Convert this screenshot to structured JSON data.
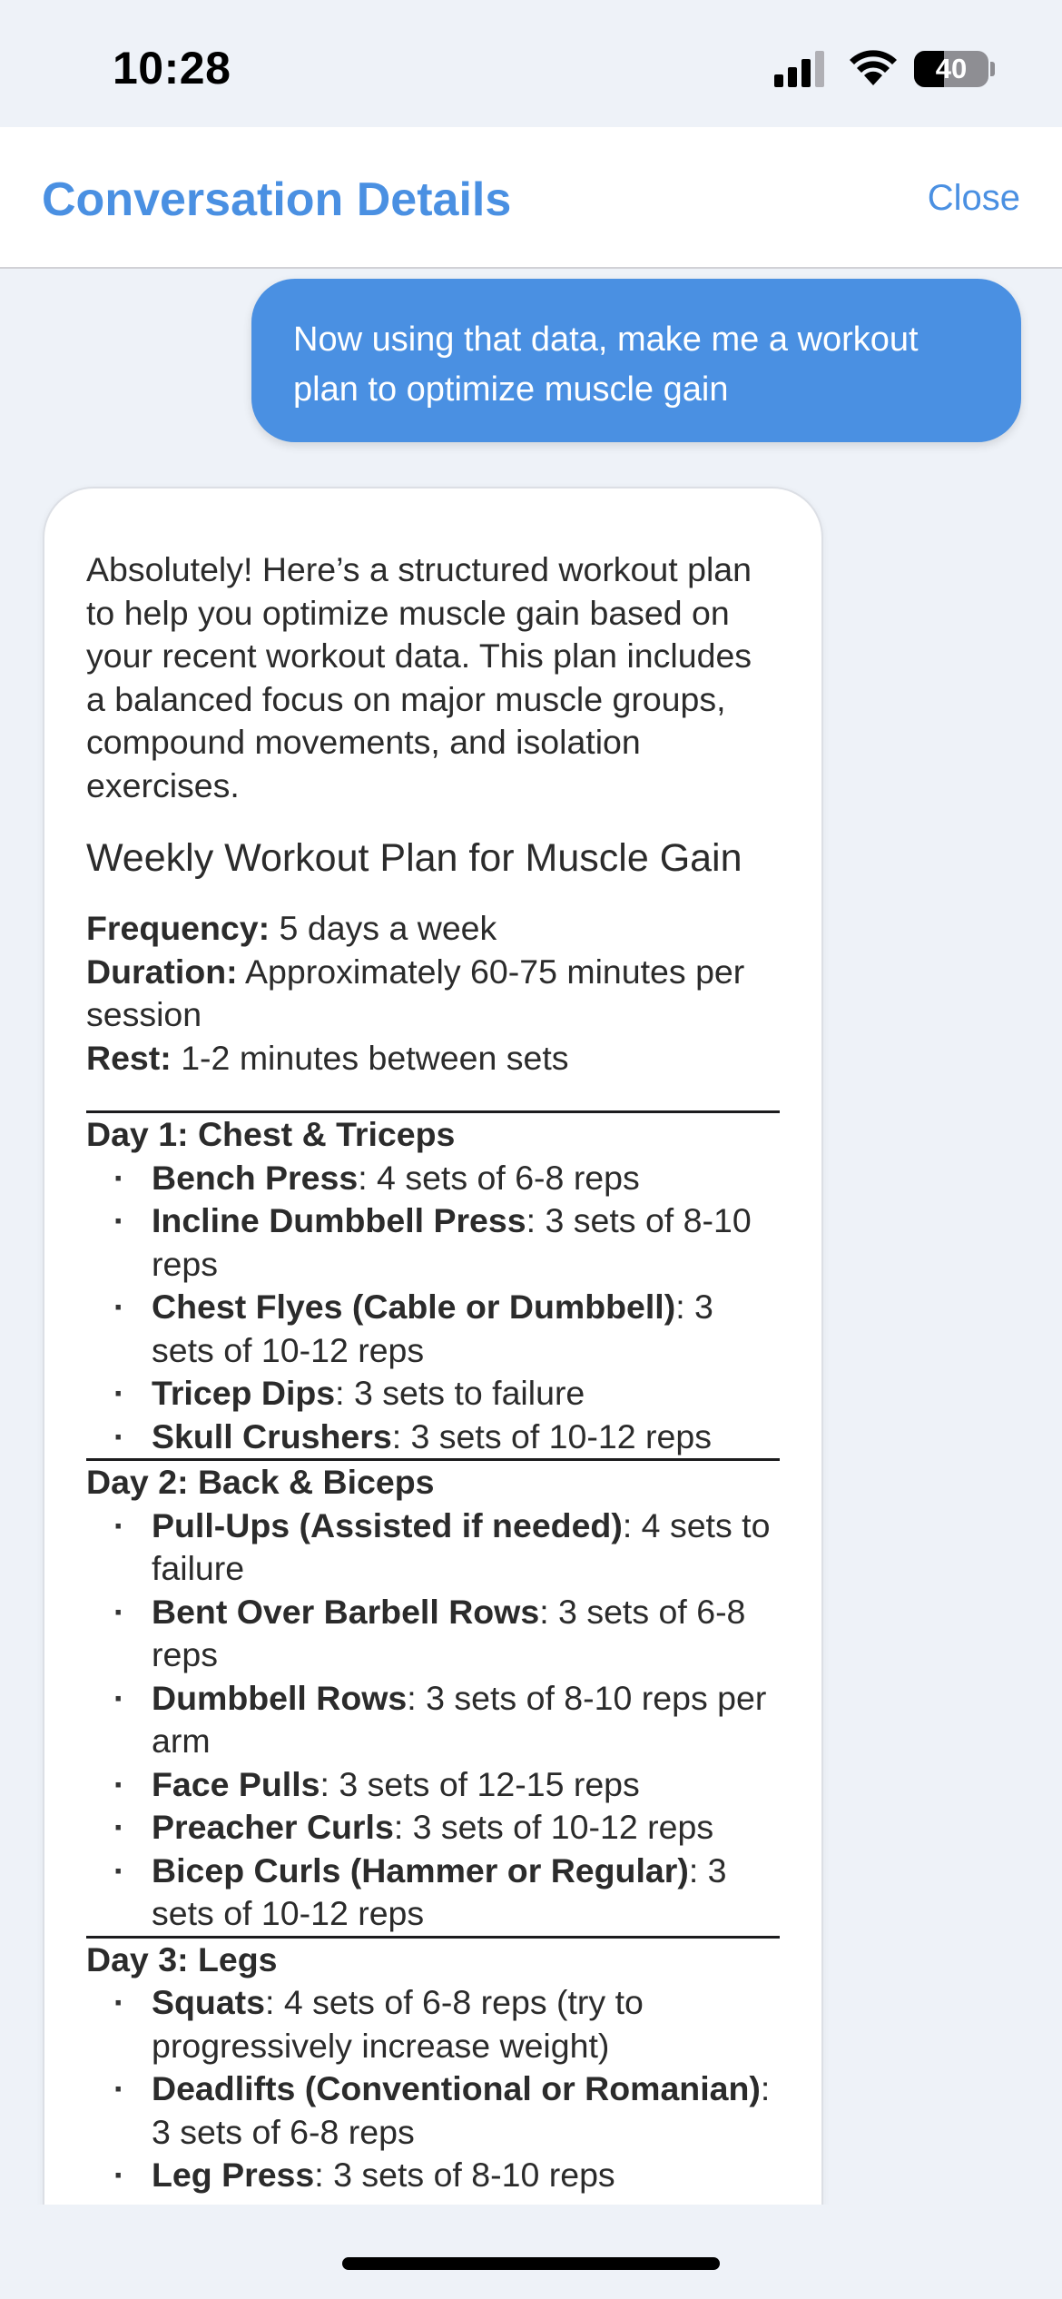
{
  "status": {
    "time": "10:28",
    "battery_level": "40",
    "battery_fraction": 0.4
  },
  "header": {
    "title": "Conversation Details",
    "close_label": "Close"
  },
  "colors": {
    "accent": "#4a90e2",
    "background": "#eef2f8"
  },
  "messages": {
    "user": "Now using that data, make me a workout plan to optimize muscle gain",
    "assistant": {
      "intro": "Absolutely! Here’s a structured workout plan to help you optimize muscle gain based on your recent workout data. This plan includes a balanced focus on major muscle groups, compound movements, and isolation exercises.",
      "plan_title": "Weekly Workout Plan for Muscle Gain",
      "meta": [
        {
          "label": "Frequency:",
          "value": " 5 days a week"
        },
        {
          "label": "Duration:",
          "value": " Approximately 60-75 minutes per session"
        },
        {
          "label": "Rest:",
          "value": " 1-2 minutes between sets"
        }
      ],
      "days": [
        {
          "title": "Day 1: Chest & Triceps",
          "exercises": [
            {
              "name": "Bench Press",
              "detail": ": 4 sets of 6-8 reps"
            },
            {
              "name": "Incline Dumbbell Press",
              "detail": ": 3 sets of 8-10 reps"
            },
            {
              "name": "Chest Flyes (Cable or Dumbbell)",
              "detail": ": 3 sets of 10-12 reps"
            },
            {
              "name": "Tricep Dips",
              "detail": ": 3 sets to failure"
            },
            {
              "name": "Skull Crushers",
              "detail": ": 3 sets of 10-12 reps"
            }
          ]
        },
        {
          "title": "Day 2: Back & Biceps",
          "exercises": [
            {
              "name": "Pull-Ups (Assisted if needed)",
              "detail": ": 4 sets to failure"
            },
            {
              "name": "Bent Over Barbell Rows",
              "detail": ": 3 sets of 6-8 reps"
            },
            {
              "name": "Dumbbell Rows",
              "detail": ": 3 sets of 8-10 reps per arm"
            },
            {
              "name": "Face Pulls",
              "detail": ": 3 sets of 12-15 reps"
            },
            {
              "name": "Preacher Curls",
              "detail": ": 3 sets of 10-12 reps"
            },
            {
              "name": "Bicep Curls (Hammer or Regular)",
              "detail": ": 3 sets of 10-12 reps"
            }
          ]
        },
        {
          "title": "Day 3: Legs",
          "exercises": [
            {
              "name": "Squats",
              "detail": ": 4 sets of 6-8 reps (try to progressively increase weight)"
            },
            {
              "name": "Deadlifts (Conventional or Romanian)",
              "detail": ": 3 sets of 6-8 reps"
            },
            {
              "name": "Leg Press",
              "detail": ": 3 sets of 8-10 reps"
            }
          ]
        }
      ]
    }
  },
  "icons": {
    "signal": "cellular-signal-icon",
    "wifi": "wifi-icon",
    "battery": "battery-icon"
  }
}
